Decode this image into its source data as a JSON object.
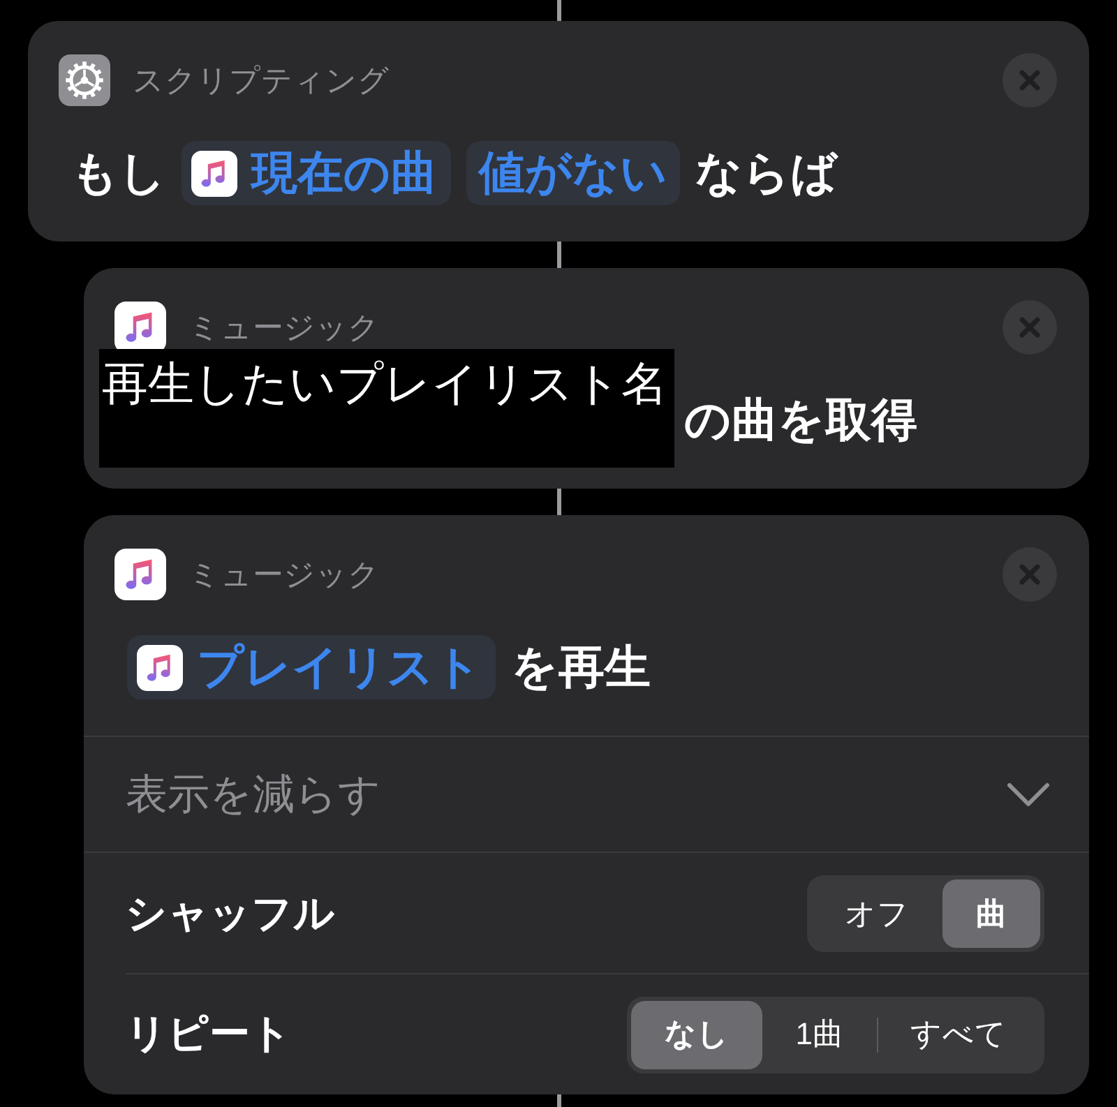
{
  "actions": [
    {
      "kind": "scripting",
      "category": "スクリプティング",
      "sentence": [
        {
          "kind": "text",
          "text": "もし"
        },
        {
          "kind": "variable",
          "text": "現在の曲"
        },
        {
          "kind": "value",
          "text": "値がない"
        },
        {
          "kind": "text",
          "text": "ならば"
        }
      ],
      "children": [
        {
          "kind": "music",
          "category": "ミュージック",
          "sentence": [
            {
              "kind": "label_overlay",
              "text": "再生したいプレイリスト名"
            },
            {
              "kind": "text",
              "text": "の曲を取得"
            }
          ]
        },
        {
          "kind": "music",
          "category": "ミュージック",
          "sentence": [
            {
              "kind": "variable",
              "text": "プレイリスト"
            },
            {
              "kind": "text",
              "text": "を再生"
            }
          ],
          "options_toggle": {
            "label": "表示を減らす",
            "expanded": true
          },
          "settings": [
            {
              "label": "シャッフル",
              "segments": [
                {
                  "label": "オフ",
                  "selected": false
                },
                {
                  "label": "曲",
                  "selected": true
                }
              ]
            },
            {
              "label": "リピート",
              "segments": [
                {
                  "label": "なし",
                  "selected": true
                },
                {
                  "label": "1曲",
                  "selected": false
                },
                {
                  "label": "すべて",
                  "selected": false
                }
              ]
            }
          ]
        }
      ]
    }
  ]
}
